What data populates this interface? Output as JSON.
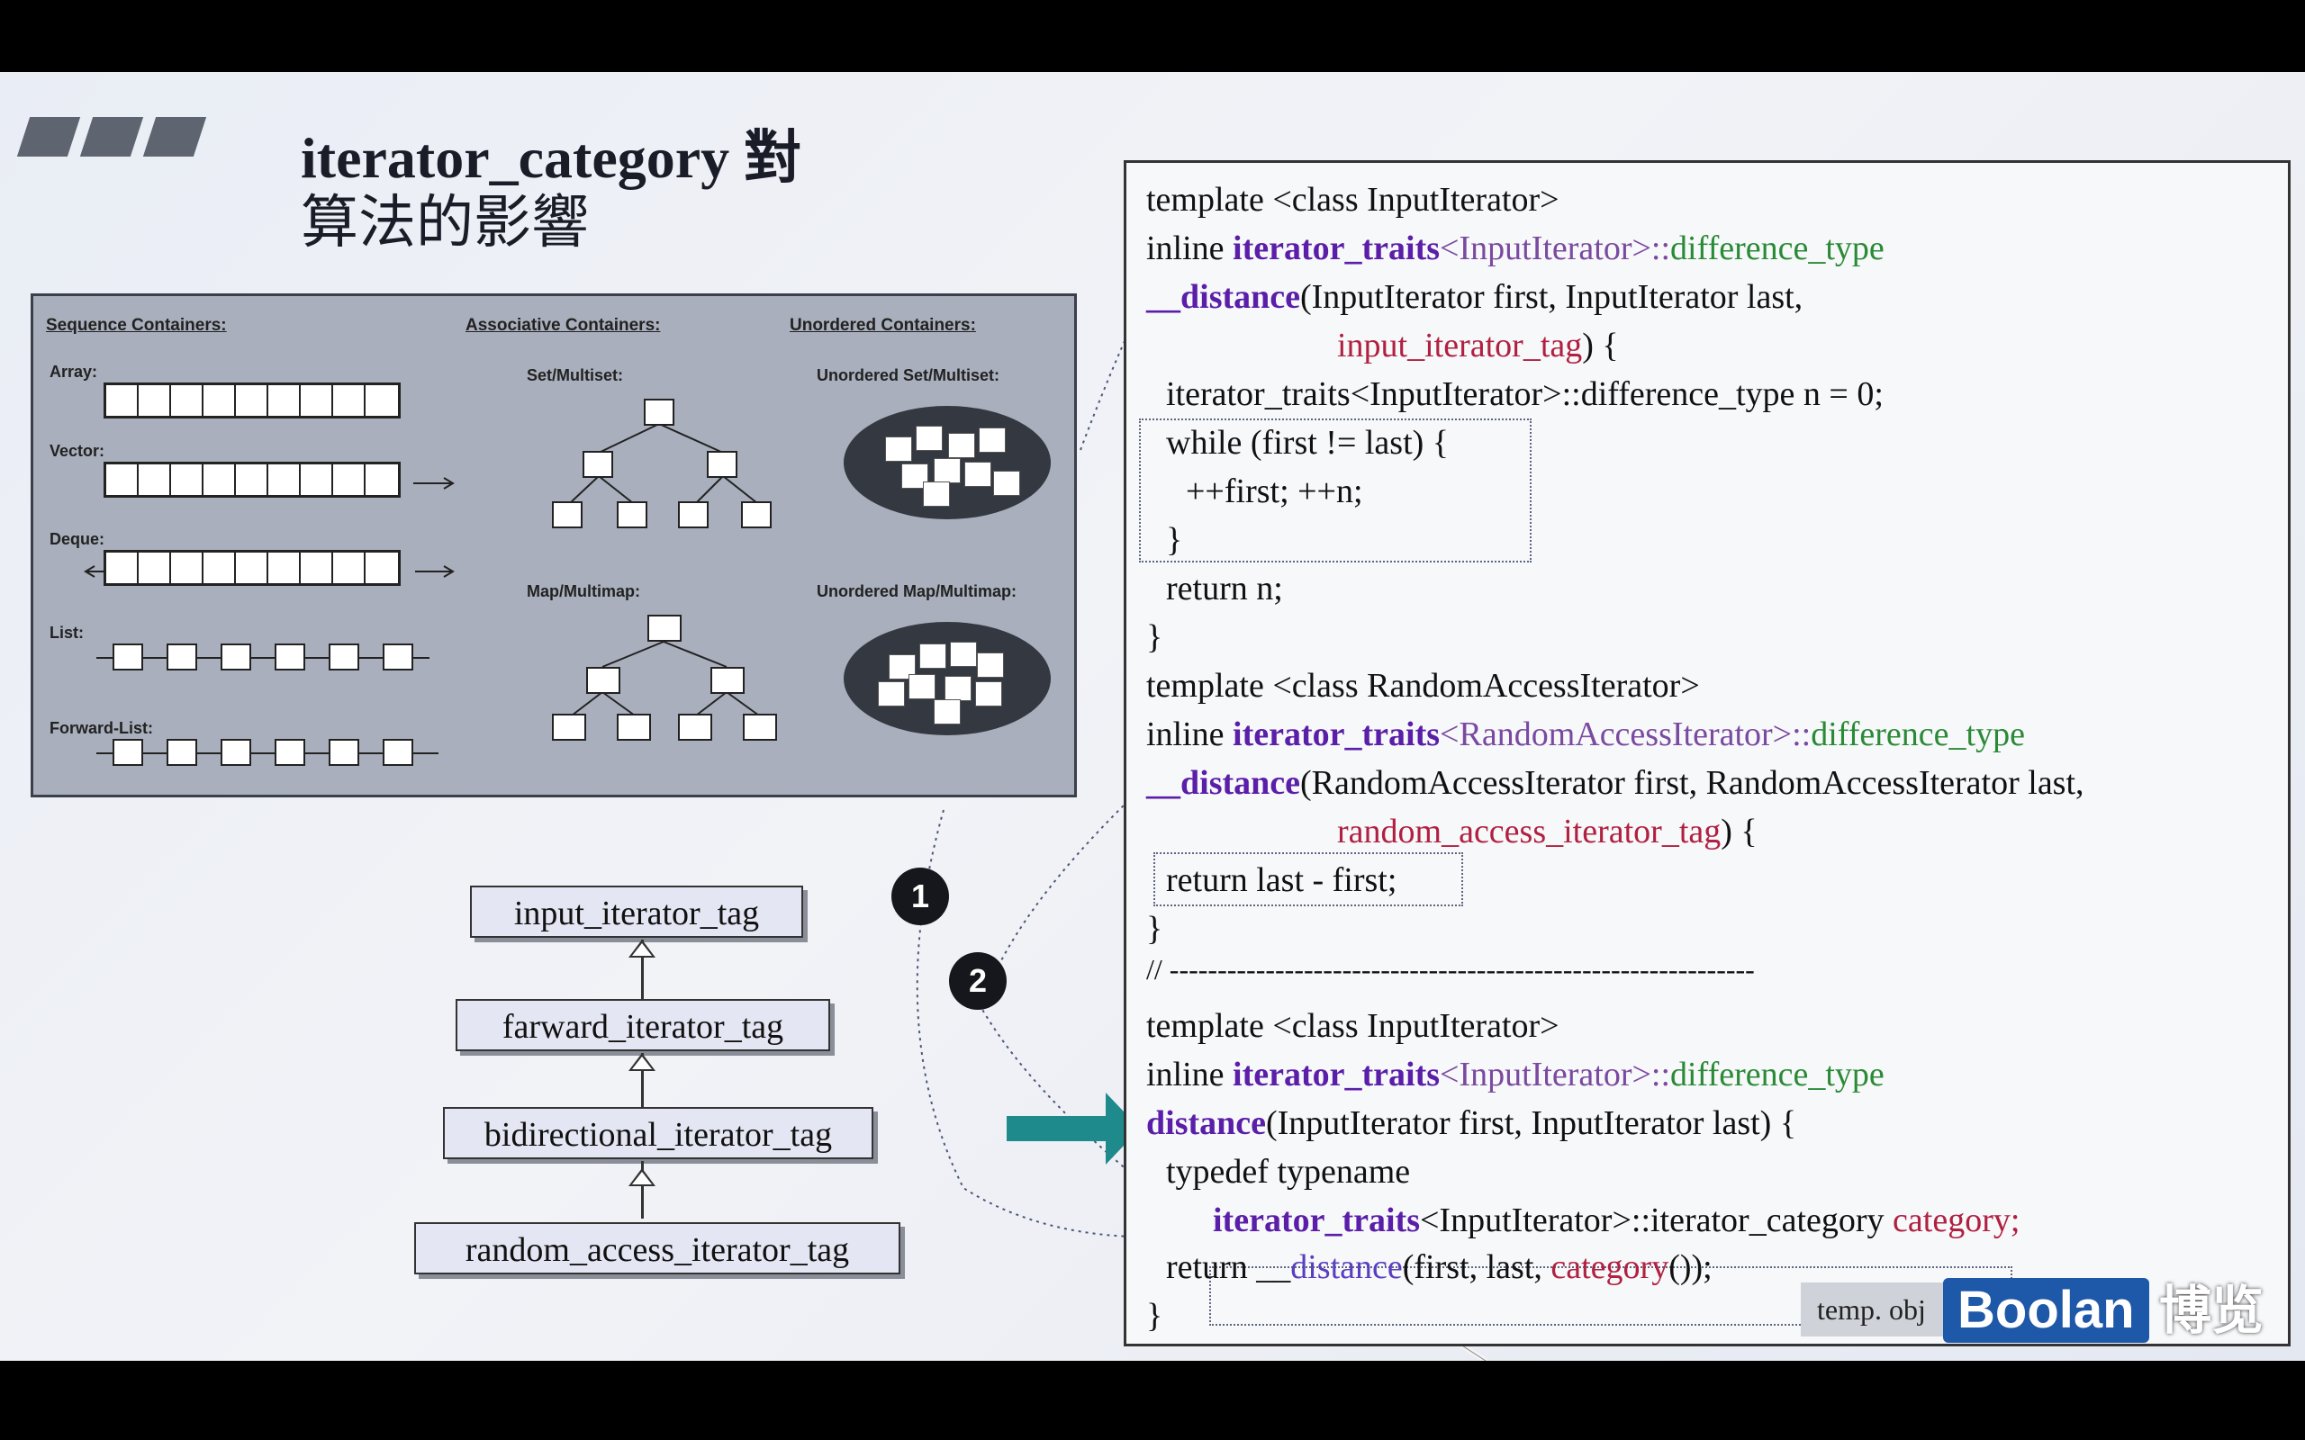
{
  "slide": {
    "title_line1": "iterator_category 對",
    "title_line2": "算法的影響"
  },
  "containers": {
    "sequence_header": "Sequence Containers:",
    "associative_header": "Associative Containers:",
    "unordered_header": "Unordered Containers:",
    "array": "Array:",
    "vector": "Vector:",
    "deque": "Deque:",
    "list": "List:",
    "forward_list": "Forward-List:",
    "set": "Set/Multiset:",
    "map": "Map/Multimap:",
    "unordered_set": "Unordered Set/Multiset:",
    "unordered_map": "Unordered Map/Multimap:"
  },
  "hierarchy": {
    "tags": [
      "input_iterator_tag",
      "farward_iterator_tag",
      "bidirectional_iterator_tag",
      "random_access_iterator_tag"
    ]
  },
  "markers": {
    "one": "1",
    "two": "2"
  },
  "code": {
    "l1": "template <class InputIterator>",
    "l2a": "inline ",
    "l2b": "iterator_traits",
    "l2c": "<InputIterator>::",
    "l2d": "difference_type",
    "l3a": "__distance",
    "l3b": "(InputIterator first, InputIterator last,",
    "l4": "input_iterator_tag",
    "l4b": ") {",
    "l5": "iterator_traits<InputIterator>::difference_type n = 0;",
    "l6": "while (first != last) {",
    "l7": "++first; ++n;",
    "l8": "}",
    "l9": "return n;",
    "l10": "}",
    "l11": "template <class RandomAccessIterator>",
    "l12a": "inline ",
    "l12b": "iterator_traits",
    "l12c": "<RandomAccessIterator>::",
    "l12d": "difference_type",
    "l13a": "__distance",
    "l13b": "(RandomAccessIterator first, RandomAccessIterator last,",
    "l14": "random_access_iterator_tag",
    "l14b": ") {",
    "l15": "return last - first;",
    "l16": "}",
    "l17": "// -------------------------------------------------------------",
    "l18": "template <class InputIterator>",
    "l19a": "inline ",
    "l19b": "iterator_traits",
    "l19c": "<InputIterator>::",
    "l19d": "difference_type",
    "l20a": "distance",
    "l20b": "(InputIterator first, InputIterator last) {",
    "l21": "typedef typename",
    "l22a": "iterator_traits",
    "l22b": "<InputIterator>::iterator_category",
    "l22c": " category;",
    "l23a": "return __",
    "l23b": "distance",
    "l23c": "(first, last, ",
    "l23d": "category",
    "l23e": "());",
    "l24": "}"
  },
  "watermark": {
    "temp": "temp. obj",
    "brand": "Boolan",
    "brand_cn": "博览"
  },
  "colors": {
    "keyword": "#5a1ea8",
    "type_name": "#2a8a36",
    "tag_name": "#b02040",
    "arrow": "#1f8a8c",
    "brand": "#1e58a8"
  }
}
